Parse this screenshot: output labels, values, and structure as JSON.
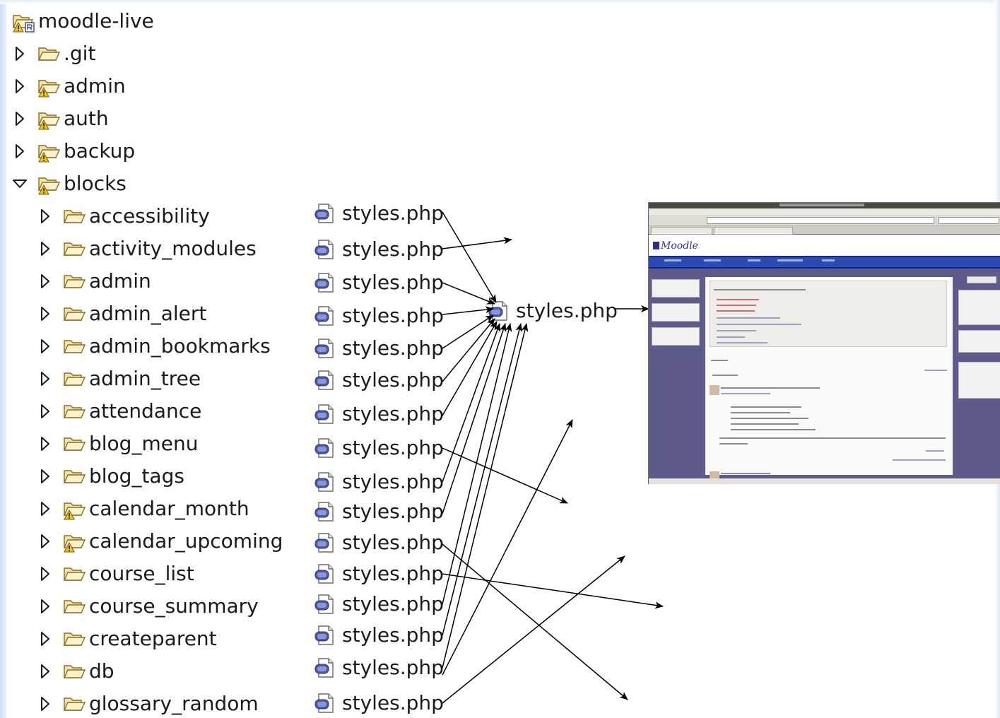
{
  "tree": {
    "root": {
      "label": "moodle-live",
      "icon": "project-icon"
    },
    "top_folders": [
      {
        "label": ".git",
        "icon": "folder-open-icon",
        "expanded": false,
        "warning": false
      },
      {
        "label": "admin",
        "icon": "folder-warning-icon",
        "expanded": false,
        "warning": true
      },
      {
        "label": "auth",
        "icon": "folder-warning-icon",
        "expanded": false,
        "warning": true
      },
      {
        "label": "backup",
        "icon": "folder-warning-icon",
        "expanded": false,
        "warning": true
      },
      {
        "label": "blocks",
        "icon": "folder-warning-icon",
        "expanded": true,
        "warning": true
      }
    ],
    "block_folders": [
      {
        "label": "accessibility",
        "warning": false
      },
      {
        "label": "activity_modules",
        "warning": false
      },
      {
        "label": "admin",
        "warning": false
      },
      {
        "label": "admin_alert",
        "warning": false
      },
      {
        "label": "admin_bookmarks",
        "warning": false
      },
      {
        "label": "admin_tree",
        "warning": false
      },
      {
        "label": "attendance",
        "warning": false
      },
      {
        "label": "blog_menu",
        "warning": false
      },
      {
        "label": "blog_tags",
        "warning": false
      },
      {
        "label": "calendar_month",
        "warning": true
      },
      {
        "label": "calendar_upcoming",
        "warning": true
      },
      {
        "label": "course_list",
        "warning": false
      },
      {
        "label": "course_summary",
        "warning": false
      },
      {
        "label": "createparent",
        "warning": false
      },
      {
        "label": "db",
        "warning": false
      },
      {
        "label": "glossary_random",
        "warning": false
      }
    ]
  },
  "files": {
    "label": "styles.php",
    "icon": "php-file-icon",
    "items": [
      "styles.php",
      "styles.php",
      "styles.php",
      "styles.php",
      "styles.php",
      "styles.php",
      "styles.php",
      "styles.php",
      "styles.php",
      "styles.php",
      "styles.php",
      "styles.php",
      "styles.php",
      "styles.php",
      "styles.php",
      "styles.php"
    ]
  },
  "combined": {
    "label": "styles.php",
    "icon": "php-file-icon"
  },
  "screenshot": {
    "logo_text": "Moodle",
    "icon": "moodle-screenshot-thumbnail"
  },
  "colors": {
    "arrow": "#000000",
    "edge": "#c9dcf5",
    "moodle_nav": "#2d49b4",
    "moodle_bg": "#5d5b8c"
  }
}
